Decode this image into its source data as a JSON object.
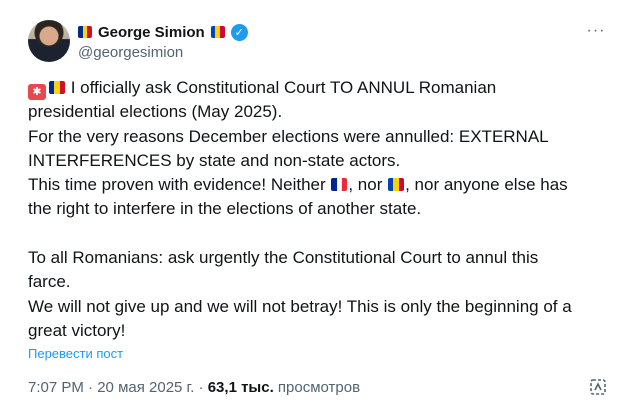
{
  "author": {
    "display_name": "George Simion",
    "handle": "@georgesimion",
    "verified": true
  },
  "flags": {
    "romania": [
      "#002b7f",
      "#fcd116",
      "#ce1126"
    ],
    "moldova": [
      "#0046ae",
      "#ffd200",
      "#cc092f"
    ],
    "france": [
      "#002395",
      "#ffffff",
      "#ed2939"
    ]
  },
  "post": {
    "line1": "I officially ask Constitutional Court TO ANNUL Romanian",
    "line2": "presidential elections (May 2025).",
    "line3": "For the very reasons December elections were annulled: EXTERNAL",
    "line4": "INTERFERENCES by state and non-state actors.",
    "line5_a": "This time proven with evidence! Neither ",
    "line5_b": ", nor ",
    "line5_c": ", nor anyone else has",
    "line6": "the right to interfere in the elections of another state.",
    "line7": "To all Romanians: ask urgently the Constitutional Court to annul this",
    "line8": "farce.",
    "line9": "We will not give up and we will not betray! This is only the beginning of a",
    "line10": "great victory!"
  },
  "translate_label": "Перевести пост",
  "meta": {
    "time": "7:07 PM",
    "separator": " · ",
    "date": "20 мая 2025 г.",
    "views_count": "63,1 тыс.",
    "views_label": " просмотров"
  },
  "icons": {
    "more": "more-options-icon",
    "share": "grok-analyze-icon",
    "verified": "verified-badge-icon",
    "siren": "siren-emoji"
  }
}
